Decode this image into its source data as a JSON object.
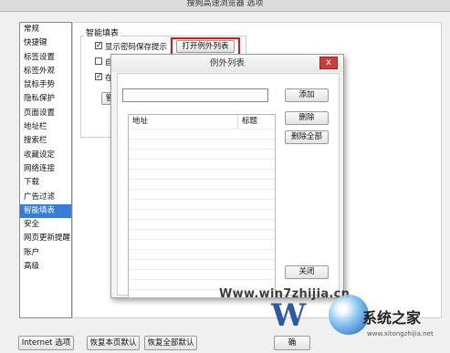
{
  "window": {
    "title": "搜狗高速浏览器 选项"
  },
  "sidebar": {
    "items": [
      {
        "label": "常规"
      },
      {
        "label": "快捷键"
      },
      {
        "label": "标签设置"
      },
      {
        "label": "标签外观"
      },
      {
        "label": "鼠标手势"
      },
      {
        "label": "隐私保护"
      },
      {
        "label": "页面设置"
      },
      {
        "label": "地址栏"
      },
      {
        "label": "搜索栏"
      },
      {
        "label": "收藏设定"
      },
      {
        "label": "网络连接"
      },
      {
        "label": "下载"
      },
      {
        "label": "广告过滤"
      },
      {
        "label": "智能填表"
      },
      {
        "label": "安全"
      },
      {
        "label": "网页更新提醒"
      },
      {
        "label": "账户"
      },
      {
        "label": "高级"
      }
    ],
    "selected": "智能填表"
  },
  "settings": {
    "group_title": "智能填表",
    "show_password_prompt": {
      "label": "显示密码保存提示",
      "checked": true
    },
    "row2_label_partial": "自",
    "row3_label_partial": "在",
    "open_exception_button": "打开例外列表",
    "partial_button_label": "管"
  },
  "dialog": {
    "title": "例外列表",
    "close_glyph": "x",
    "input_value": "",
    "add_button": "添加",
    "delete_button": "删除",
    "delete_all_button": "删除全部",
    "close_button": "关闭",
    "columns": [
      "地址",
      "标题"
    ]
  },
  "bottom": {
    "internet_options": "Internet 选项",
    "restore_page_default": "恢复本页默认",
    "restore_all_default": "恢复全部默认",
    "ok_partial": "确"
  },
  "watermark": {
    "site": "Www.win7zhijia.cn",
    "logo_letter": "W",
    "brand": "系统之家",
    "url": "www.xitongzhijia.net"
  }
}
